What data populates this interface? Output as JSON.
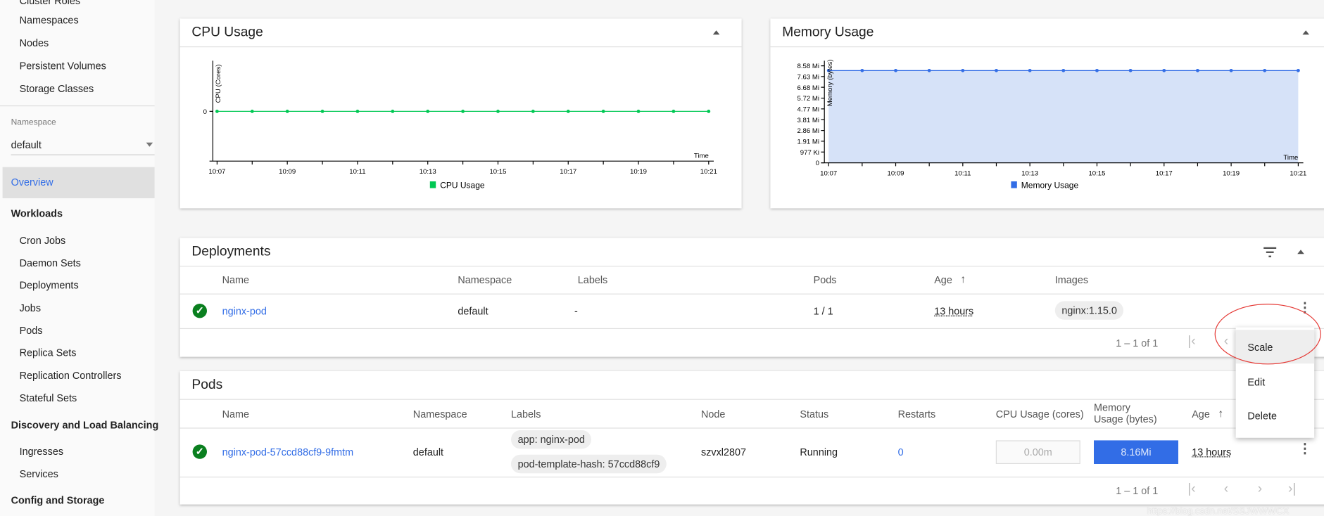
{
  "sidebar": {
    "cluster_items": [
      "Cluster Roles",
      "Namespaces",
      "Nodes",
      "Persistent Volumes",
      "Storage Classes"
    ],
    "namespace_label": "Namespace",
    "namespace_value": "default",
    "overview": "Overview",
    "workloads_heading": "Workloads",
    "workloads_items": [
      "Cron Jobs",
      "Daemon Sets",
      "Deployments",
      "Jobs",
      "Pods",
      "Replica Sets",
      "Replication Controllers",
      "Stateful Sets"
    ],
    "discovery_heading": "Discovery and Load Balancing",
    "discovery_items": [
      "Ingresses",
      "Services"
    ],
    "config_heading": "Config and Storage"
  },
  "colors": {
    "accent": "#326de6",
    "cpu": "#00c853",
    "memory": "#326de6",
    "memory_fill": "#d6e2f8",
    "ok": "#0a7f1f",
    "annotation": "#e53935"
  },
  "chart_data": [
    {
      "type": "line",
      "title": "CPU Usage",
      "ylabel": "CPU (Cores)",
      "xlabel": "Time",
      "x": [
        "10:07",
        "10:08",
        "10:09",
        "10:10",
        "10:11",
        "10:12",
        "10:13",
        "10:14",
        "10:15",
        "10:16",
        "10:17",
        "10:18",
        "10:19",
        "10:20",
        "10:21"
      ],
      "x_tick_labels": [
        "10:07",
        "10:09",
        "10:11",
        "10:13",
        "10:15",
        "10:17",
        "10:19",
        "10:21"
      ],
      "y_tick_labels": [
        "0"
      ],
      "series": [
        {
          "name": "CPU Usage",
          "values": [
            0,
            0,
            0,
            0,
            0,
            0,
            0,
            0,
            0,
            0,
            0,
            0,
            0,
            0,
            0
          ]
        }
      ],
      "legend": "bottom"
    },
    {
      "type": "area",
      "title": "Memory Usage",
      "ylabel": "Memory (bytes)",
      "xlabel": "Time",
      "x": [
        "10:07",
        "10:08",
        "10:09",
        "10:10",
        "10:11",
        "10:12",
        "10:13",
        "10:14",
        "10:15",
        "10:16",
        "10:17",
        "10:18",
        "10:19",
        "10:20",
        "10:21"
      ],
      "x_tick_labels": [
        "10:07",
        "10:09",
        "10:11",
        "10:13",
        "10:15",
        "10:17",
        "10:19",
        "10:21"
      ],
      "y_tick_labels": [
        "0",
        "977 Ki",
        "1.91 Mi",
        "2.86 Mi",
        "3.81 Mi",
        "4.77 Mi",
        "5.72 Mi",
        "6.68 Mi",
        "7.63 Mi",
        "8.58 Mi"
      ],
      "ylim_mi": [
        0,
        8.58
      ],
      "series": [
        {
          "name": "Memory Usage",
          "values_mi": [
            8.16,
            8.16,
            8.16,
            8.16,
            8.16,
            8.16,
            8.16,
            8.16,
            8.16,
            8.16,
            8.16,
            8.16,
            8.16,
            8.16,
            8.16
          ]
        }
      ],
      "legend": "bottom"
    }
  ],
  "deployments": {
    "title": "Deployments",
    "columns": [
      "Name",
      "Namespace",
      "Labels",
      "Pods",
      "Age",
      "Images"
    ],
    "row": {
      "name": "nginx-pod",
      "namespace": "default",
      "labels": "-",
      "pods": "1 / 1",
      "age": "13 hours",
      "image": "nginx:1.15.0"
    },
    "pagination": "1 – 1 of 1"
  },
  "pods": {
    "title": "Pods",
    "columns": [
      "Name",
      "Namespace",
      "Labels",
      "Node",
      "Status",
      "Restarts",
      "CPU Usage (cores)",
      "Memory Usage (bytes)",
      "Age"
    ],
    "row": {
      "name": "nginx-pod-57ccd88cf9-9fmtm",
      "namespace": "default",
      "labels": [
        "app: nginx-pod",
        "pod-template-hash: 57ccd88cf9"
      ],
      "node": "szvxl2807",
      "status": "Running",
      "restarts": "0",
      "cpu": "0.00m",
      "memory": "8.16Mi",
      "age": "13 hours"
    },
    "pagination": "1 – 1 of 1"
  },
  "menu": {
    "items": [
      "Scale",
      "Edit",
      "Delete"
    ]
  },
  "watermark": "https://blog.csdn.net/SSJWWWCX"
}
